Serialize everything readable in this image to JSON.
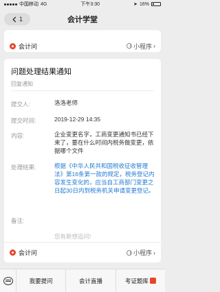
{
  "status_bar": {
    "carrier": "中国移动",
    "network": "4G",
    "time": "下午3:30",
    "battery": "16%"
  },
  "nav": {
    "back_count": "1",
    "title": "会计学堂"
  },
  "mini_program": {
    "name": "会计问",
    "link_label": "小程序"
  },
  "message": {
    "title": "问题处理结果通知",
    "subtitle": "回复通知",
    "fields": [
      {
        "label": "提交人:",
        "value": "洛洛老师"
      },
      {
        "label": "提交时间:",
        "value": "2019-12-29 14:35"
      },
      {
        "label": "内容:",
        "value": "企业变更名字，工商变更通知书已经下来了，要在什么时间内税务做变更，依据哪个文件"
      },
      {
        "label": "处理结果:",
        "value": "根据《中华人民共和国税收征收管理法》第16条第一款的规定，税务登记内容发生变化的，应当自工商部门变更之日起30日内到税务机关申请变更登记。"
      },
      {
        "label": "备注:",
        "value": "您有新想追问!"
      }
    ]
  },
  "tabbar": {
    "items": [
      "我要提问",
      "会计直播",
      "考证题库"
    ]
  },
  "colors": {
    "accent_red": "#e64528",
    "link_blue": "#1f78d1"
  }
}
